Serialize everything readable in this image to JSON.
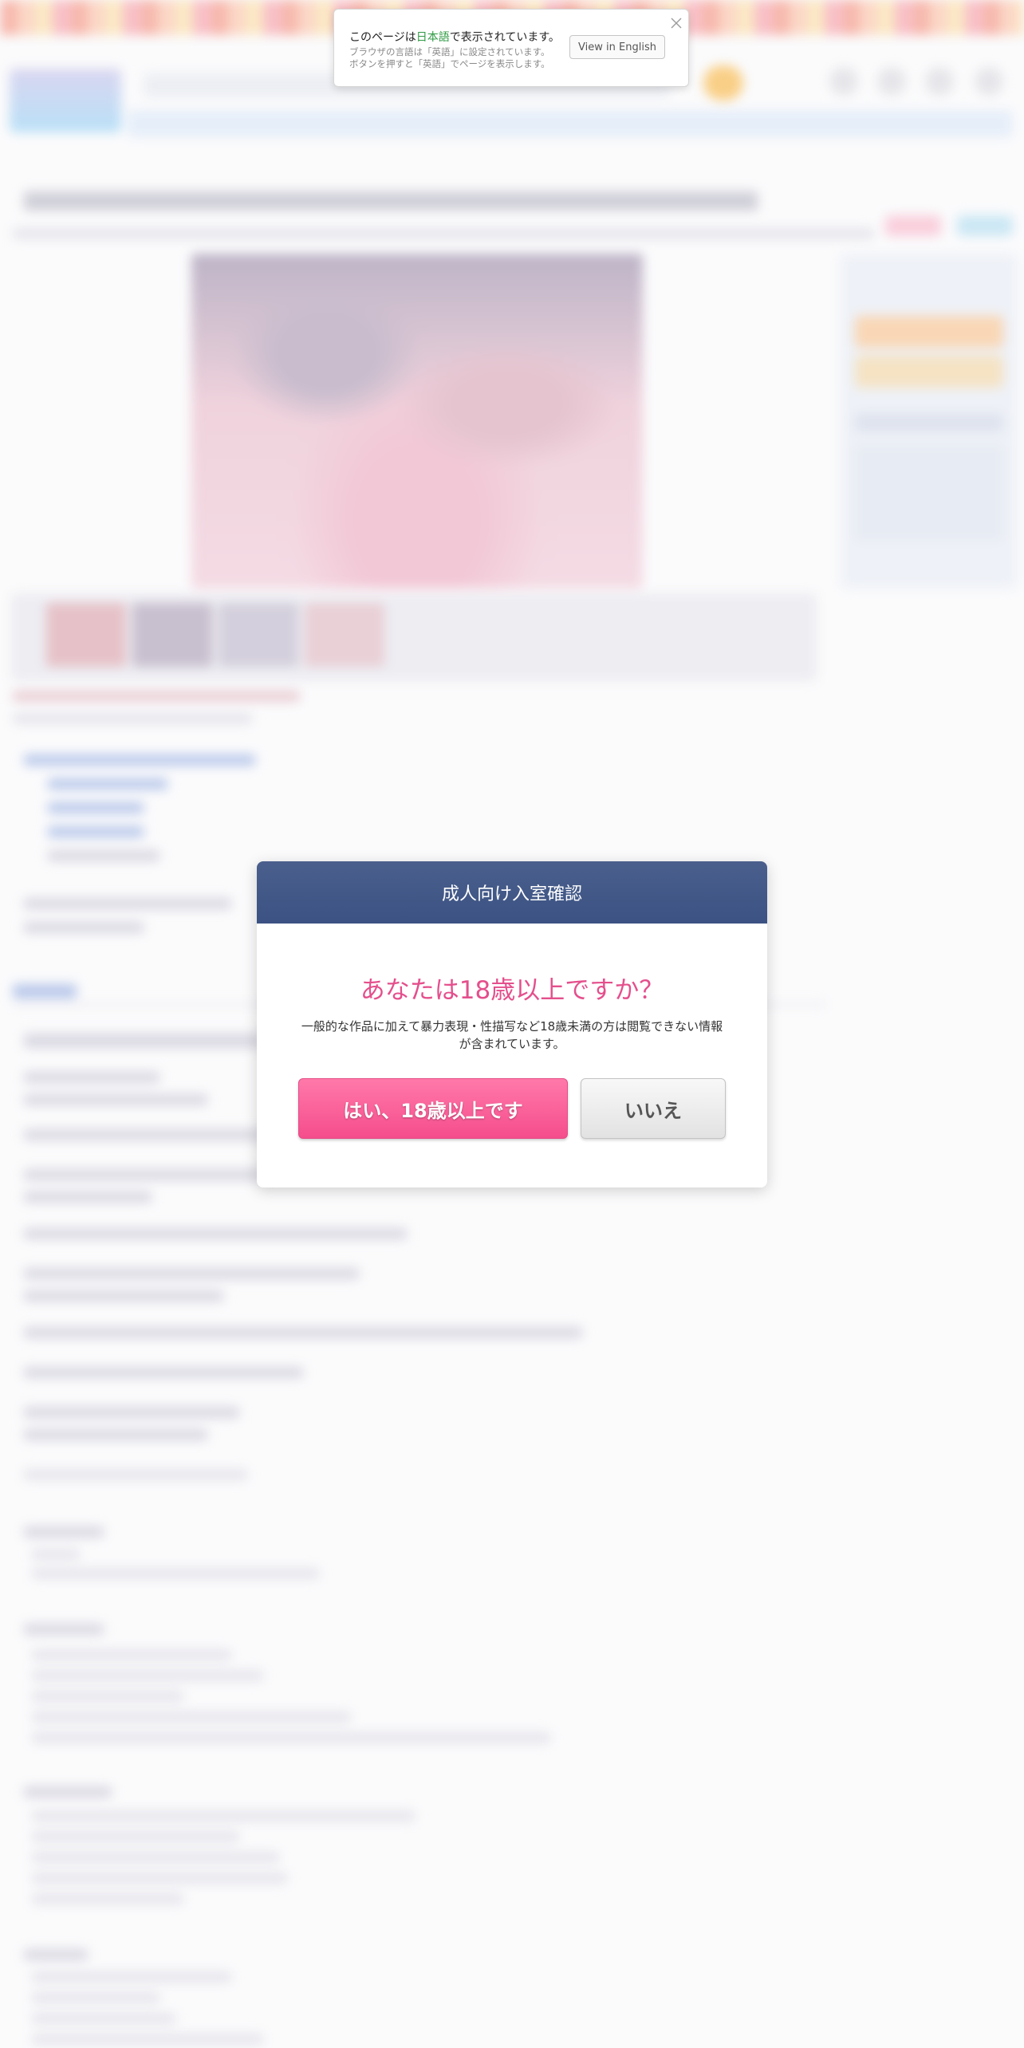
{
  "language_banner": {
    "message_prefix": "このページは",
    "language_name": "日本語",
    "message_suffix": "で表示されています。",
    "browser_note_line1": "ブラウザの言語は「英語」に設定されています。",
    "browser_note_line2": "ボタンを押すと「英語」でページを表示します。",
    "view_button_label": "View in English",
    "close_icon": "close-icon",
    "language_color": "#2e9a43"
  },
  "age_gate": {
    "title": "成人向け入室確認",
    "question": "あなたは18歳以上ですか？",
    "description": "一般的な作品に加えて暴力表現・性描写など18歳未満の方は閲覧できない情報が含まれています。",
    "yes_label": "はい、18歳以上です",
    "no_label": "いいえ",
    "header_color": "#3f5585",
    "question_color": "#e44f8c",
    "yes_color": "#f7548f"
  }
}
